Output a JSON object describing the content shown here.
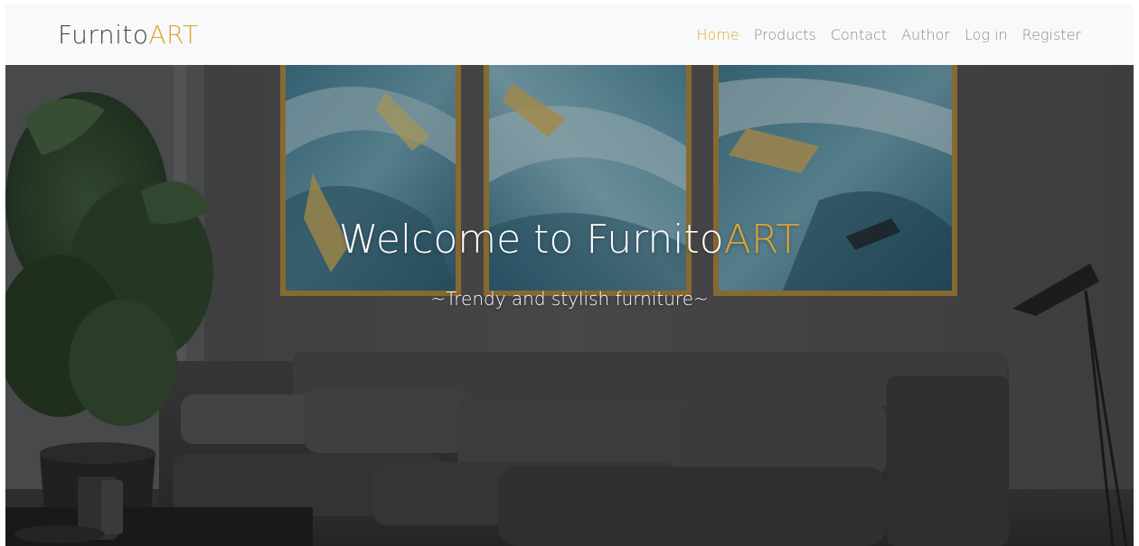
{
  "navbar": {
    "brand": {
      "part1": "Furnito",
      "part2": "ART"
    },
    "links": [
      {
        "label": "Home",
        "active": true
      },
      {
        "label": "Products",
        "active": false
      },
      {
        "label": "Contact",
        "active": false
      },
      {
        "label": "Author",
        "active": false
      },
      {
        "label": "Log in",
        "active": false
      },
      {
        "label": "Register",
        "active": false
      }
    ]
  },
  "hero": {
    "title": {
      "part1": "Welcome to Furnito",
      "part2": "ART"
    },
    "subtitle": "~Trendy and stylish furniture~"
  },
  "colors": {
    "accent": "#e0a431",
    "nav_background": "#f8f9fa",
    "nav_link": "#8a8a8a",
    "hero_text": "#ffffff"
  },
  "icons": [
    "hero-background-image"
  ]
}
